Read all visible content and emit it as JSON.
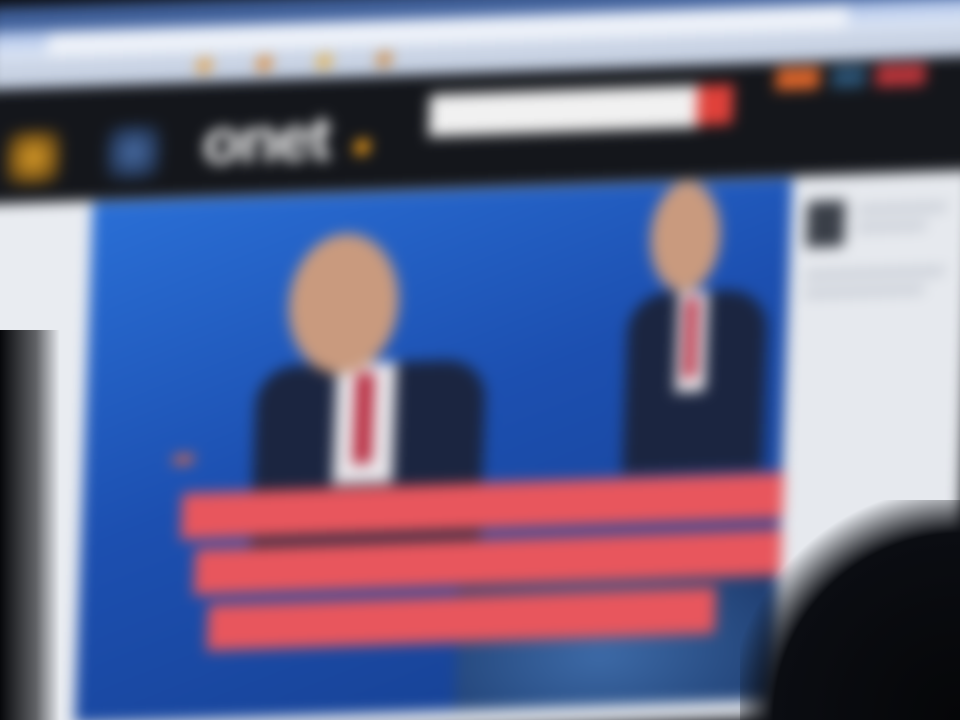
{
  "browser": {
    "window_title": "",
    "address": ""
  },
  "site": {
    "logo_text": "onet",
    "search": {
      "value": "",
      "placeholder": ""
    }
  },
  "hero": {
    "badge": "",
    "headline_lines": [
      "",
      "",
      ""
    ]
  },
  "colors": {
    "header_bg": "#14161b",
    "hero_blue": "#1c4fb0",
    "headline_red": "#e8565d",
    "badge_orange": "#f26a3b",
    "logo_dot": "#f7a21b",
    "search_button": "#e0413a"
  },
  "icons": [
    "search-icon",
    "weather-icon",
    "mail-icon"
  ]
}
